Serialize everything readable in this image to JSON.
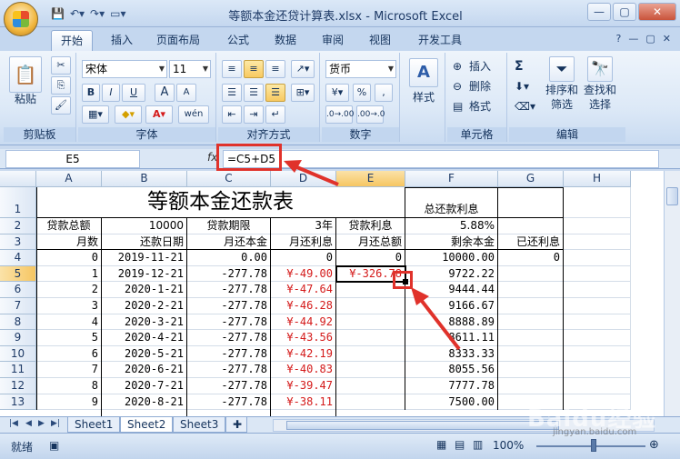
{
  "window": {
    "title": "等额本金还贷计算表.xlsx - Microsoft Excel",
    "qat_icons": [
      "save-icon",
      "undo-icon",
      "redo-icon",
      "customize-icon"
    ],
    "controls": [
      "—",
      "▢",
      "✕"
    ]
  },
  "ribbon": {
    "tabs": [
      "开始",
      "插入",
      "页面布局",
      "公式",
      "数据",
      "审阅",
      "视图",
      "开发工具"
    ],
    "active_tab": "开始",
    "clipboard": {
      "paste": "粘贴",
      "label": "剪贴板"
    },
    "font": {
      "name": "宋体",
      "size": "11",
      "bold": "B",
      "italic": "I",
      "underline": "U",
      "grow": "A",
      "shrink": "A",
      "wen": "wén",
      "label": "字体"
    },
    "alignment": {
      "label": "对齐方式"
    },
    "number": {
      "format": "货币",
      "percent": "%",
      "comma": ",",
      "label": "数字"
    },
    "styles": {
      "label": "样式"
    },
    "cells": {
      "insert": "插入",
      "delete": "删除",
      "format": "格式",
      "label": "单元格"
    },
    "editing": {
      "sort": "排序和",
      "sort2": "筛选",
      "find": "查找和",
      "find2": "选择",
      "sigma": "Σ",
      "label": "编辑"
    }
  },
  "formula_bar": {
    "name_box": "E5",
    "fx": "fx",
    "formula": "=C5+D5"
  },
  "grid": {
    "columns": [
      "A",
      "B",
      "C",
      "D",
      "E",
      "F",
      "G",
      "H"
    ],
    "selected_column": "E",
    "rows": [
      "1",
      "2",
      "3",
      "4",
      "5",
      "6",
      "7",
      "8",
      "9",
      "10",
      "11",
      "12",
      "13"
    ],
    "selected_row": "5",
    "title": "等额本金还款表",
    "total_interest_label": "总还款利息",
    "row2": {
      "A": "贷款总额",
      "B": "10000",
      "C": "贷款期限",
      "D": "3年",
      "E": "贷款利息",
      "F": "5.88%"
    },
    "row3": {
      "A": "月数",
      "B": "还款日期",
      "C": "月还本金",
      "D": "月还利息",
      "E": "月还总额",
      "F": "剩余本金",
      "G": "已还利息"
    },
    "data": [
      {
        "A": "0",
        "B": "2019-11-21",
        "C": "0.00",
        "D": "0",
        "E": "0",
        "F": "10000.00",
        "G": "0"
      },
      {
        "A": "1",
        "B": "2019-12-21",
        "C": "-277.78",
        "D": "¥-49.00",
        "E": "¥-326.78",
        "F": "9722.22",
        "G": ""
      },
      {
        "A": "2",
        "B": "2020-1-21",
        "C": "-277.78",
        "D": "¥-47.64",
        "E": "",
        "F": "9444.44",
        "G": ""
      },
      {
        "A": "3",
        "B": "2020-2-21",
        "C": "-277.78",
        "D": "¥-46.28",
        "E": "",
        "F": "9166.67",
        "G": ""
      },
      {
        "A": "4",
        "B": "2020-3-21",
        "C": "-277.78",
        "D": "¥-44.92",
        "E": "",
        "F": "8888.89",
        "G": ""
      },
      {
        "A": "5",
        "B": "2020-4-21",
        "C": "-277.78",
        "D": "¥-43.56",
        "E": "",
        "F": "8611.11",
        "G": ""
      },
      {
        "A": "6",
        "B": "2020-5-21",
        "C": "-277.78",
        "D": "¥-42.19",
        "E": "",
        "F": "8333.33",
        "G": ""
      },
      {
        "A": "7",
        "B": "2020-6-21",
        "C": "-277.78",
        "D": "¥-40.83",
        "E": "",
        "F": "8055.56",
        "G": ""
      },
      {
        "A": "8",
        "B": "2020-7-21",
        "C": "-277.78",
        "D": "¥-39.47",
        "E": "",
        "F": "7777.78",
        "G": ""
      },
      {
        "A": "9",
        "B": "2020-8-21",
        "C": "-277.78",
        "D": "¥-38.11",
        "E": "",
        "F": "7500.00",
        "G": ""
      }
    ]
  },
  "sheets": [
    "Sheet1",
    "Sheet2",
    "Sheet3"
  ],
  "active_sheet": "Sheet2",
  "status": {
    "mode": "就绪",
    "zoom": "100%"
  },
  "watermark": {
    "main": "Baidu经验",
    "sub": "jingyan.baidu.com"
  },
  "colors": {
    "accent_red": "#e0322b",
    "negative_red": "#d41a1a",
    "ribbon_blue": "#dde9f7"
  }
}
